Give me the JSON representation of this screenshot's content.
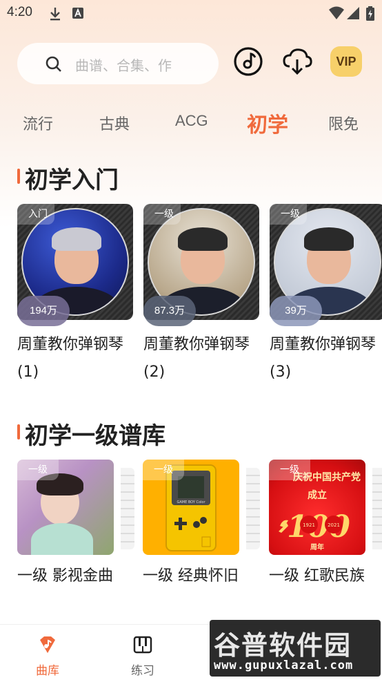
{
  "status_bar": {
    "time": "4:20"
  },
  "header": {
    "search_placeholder": "曲谱、合集、作",
    "vip_label": "VIP"
  },
  "tabs": [
    {
      "label": "流行",
      "active": false
    },
    {
      "label": "古典",
      "active": false
    },
    {
      "label": "ACG",
      "active": false
    },
    {
      "label": "初学",
      "active": true
    },
    {
      "label": "限免",
      "active": false
    }
  ],
  "section1": {
    "title": "初学入门",
    "cards": [
      {
        "tag": "入门",
        "plays": "194万",
        "title": "周董教你弹钢琴 (1)"
      },
      {
        "tag": "一级",
        "plays": "87.3万",
        "title": "周董教你弹钢琴 (2)"
      },
      {
        "tag": "一级",
        "plays": "39万",
        "title": "周董教你弹钢琴 (3)"
      }
    ]
  },
  "section2": {
    "title": "初学一级谱库",
    "cards": [
      {
        "tag": "一级",
        "title": "一级 影视金曲"
      },
      {
        "tag": "一级",
        "title": "一级 经典怀旧",
        "cover_text": "GAME BOY Color"
      },
      {
        "tag": "一级",
        "title": "一级 红歌民族",
        "cover_text_1": "庆祝中国共产党",
        "cover_text_2": "成立",
        "cover_text_3": "100",
        "cover_text_4": "周年",
        "cover_text_5": "1921",
        "cover_text_6": "2021"
      }
    ]
  },
  "bottom_nav": [
    {
      "label": "曲库",
      "active": true
    },
    {
      "label": "练习",
      "active": false
    }
  ],
  "watermark": {
    "main": "谷普软件园",
    "url": "www.gupuxlazal.com"
  },
  "colors": {
    "accent": "#f06a3c",
    "vip": "#f7d06a"
  }
}
